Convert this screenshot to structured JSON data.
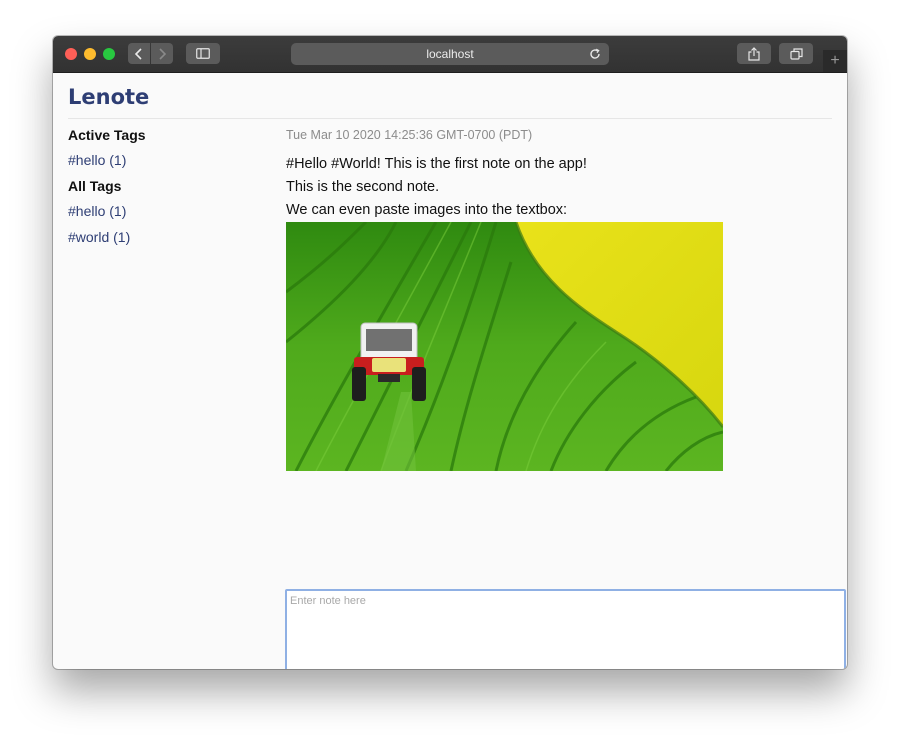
{
  "browser": {
    "url": "localhost"
  },
  "app": {
    "title": "Lenote"
  },
  "sidebar": {
    "active_tags_heading": "Active Tags",
    "active_tags": [
      "#hello (1)"
    ],
    "all_tags_heading": "All Tags",
    "all_tags": [
      "#hello (1)",
      "#world (1)"
    ]
  },
  "notes": {
    "timestamp": "Tue Mar 10 2020 14:25:36 GMT-0700 (PDT)",
    "lines": [
      "#Hello #World! This is the first note on the app!",
      "This is the second note.",
      "We can even paste images into the textbox:"
    ]
  },
  "input": {
    "value": "",
    "placeholder": "Enter note here"
  },
  "colors": {
    "accent": "#2e3e74",
    "input_focus": "#8fb0e4"
  },
  "icons": [
    "back-icon",
    "forward-icon",
    "sidebar-icon",
    "reload-icon",
    "share-icon",
    "tabs-icon",
    "new-tab-icon"
  ]
}
